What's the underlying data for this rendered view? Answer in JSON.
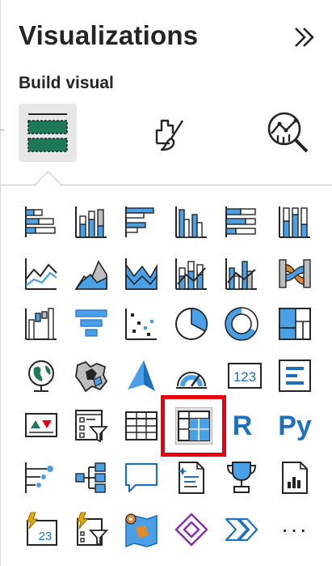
{
  "pane": {
    "title": "Visualizations",
    "collapse_icon": "double-chevron-right-icon",
    "subtitle": "Build visual"
  },
  "modes": [
    {
      "name": "build-visual",
      "icon": "fields-icon",
      "active": true
    },
    {
      "name": "format-visual",
      "icon": "format-brush-icon",
      "active": false
    },
    {
      "name": "analytics",
      "icon": "analytics-magnifier-icon",
      "active": false
    }
  ],
  "visuals": [
    "stacked-bar-chart-icon",
    "stacked-column-chart-icon",
    "clustered-bar-chart-icon",
    "clustered-column-chart-icon",
    "100-stacked-bar-chart-icon",
    "100-stacked-column-chart-icon",
    "line-chart-icon",
    "area-chart-icon",
    "stacked-area-chart-icon",
    "line-and-stacked-column-chart-icon",
    "line-and-clustered-column-chart-icon",
    "ribbon-chart-icon",
    "waterfall-chart-icon",
    "funnel-icon",
    "scatter-chart-icon",
    "pie-chart-icon",
    "donut-chart-icon",
    "treemap-icon",
    "map-icon",
    "filled-map-icon",
    "azure-map-icon",
    "gauge-icon",
    "card-icon",
    "multi-row-card-icon",
    "kpi-icon",
    "slicer-icon",
    "table-icon",
    "matrix-icon",
    "r-script-visual-icon",
    "python-visual-icon",
    "key-influencers-icon",
    "decomposition-tree-icon",
    "qa-icon",
    "smart-narrative-icon",
    "metrics-icon",
    "paginated-report-icon",
    "power-automate-icon",
    "power-apps-slicer-icon",
    "arcgis-map-icon",
    "power-apps-icon",
    "power-automate-flow-icon",
    "more-visuals-icon"
  ],
  "selected_visual": "matrix-icon",
  "labels": {
    "card_text": "123",
    "r_text": "R",
    "py_text": "Py",
    "more_text": "···",
    "auto_text": "23"
  },
  "colors": {
    "accent_blue": "#1f6fbf",
    "light_blue": "#4aa0e6",
    "gray": "#8a8886",
    "green": "#1e7a56",
    "selection_red": "#e8000d"
  }
}
